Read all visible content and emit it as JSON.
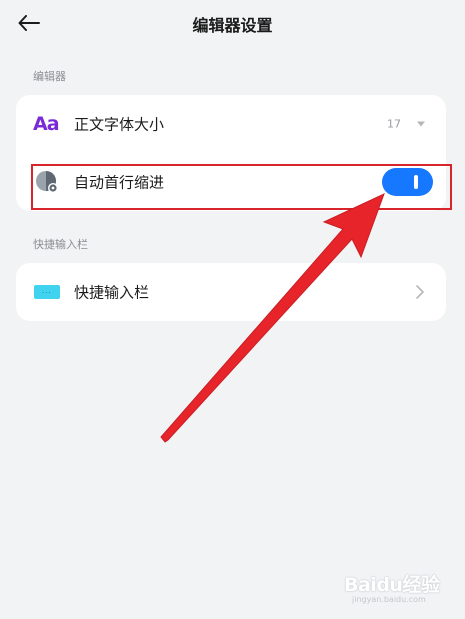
{
  "header": {
    "title": "编辑器设置",
    "back_icon": "arrow-left-icon"
  },
  "sections": {
    "editor_label": "编辑器",
    "quick_input_label": "快捷输入栏"
  },
  "editor_card": {
    "font_size": {
      "icon_text": "Aa",
      "label": "正文字体大小",
      "value": "17"
    },
    "auto_indent": {
      "label": "自动首行缩进",
      "enabled": true
    }
  },
  "quick_input_card": {
    "label": "快捷输入栏",
    "icon_text": "..."
  },
  "colors": {
    "accent": "#1677ff",
    "annotation_red": "#e8242b",
    "font_icon": "#7b2bd6",
    "keyboard_icon": "#3fd3ef"
  },
  "watermark": {
    "text": "Baidu经验",
    "sub": "jingyan.baidu.com"
  }
}
